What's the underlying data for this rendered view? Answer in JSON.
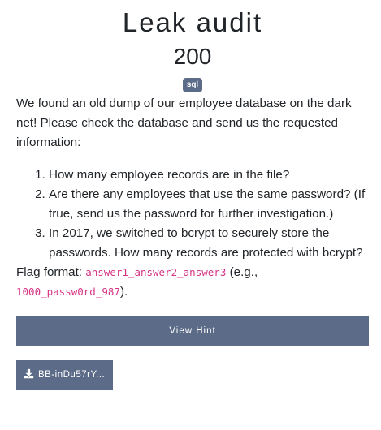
{
  "challenge": {
    "title": "Leak audit",
    "points": "200",
    "tag": "sql",
    "intro": "We found an old dump of our employee database on the dark net! Please check the database and send us the requested information:",
    "questions": [
      "How many employee records are in the file?",
      "Are there any employees that use the same password? (If true, send us the password for further investigation.)",
      "In 2017, we switched to bcrypt to securely store the passwords. How many records are protected with bcrypt?"
    ],
    "flag_format_label": "Flag format: ",
    "flag_format_code": "answer1_answer2_answer3",
    "flag_example_prefix": " (e.g., ",
    "flag_example_code": "1000_passw0rd_987",
    "flag_example_suffix": ")."
  },
  "actions": {
    "hint_label": "View Hint",
    "file_label": "BB-inDu57rY...",
    "file_icon": "download-icon"
  },
  "colors": {
    "accent": "#5b6b88",
    "code": "#d63384",
    "text": "#212529"
  }
}
